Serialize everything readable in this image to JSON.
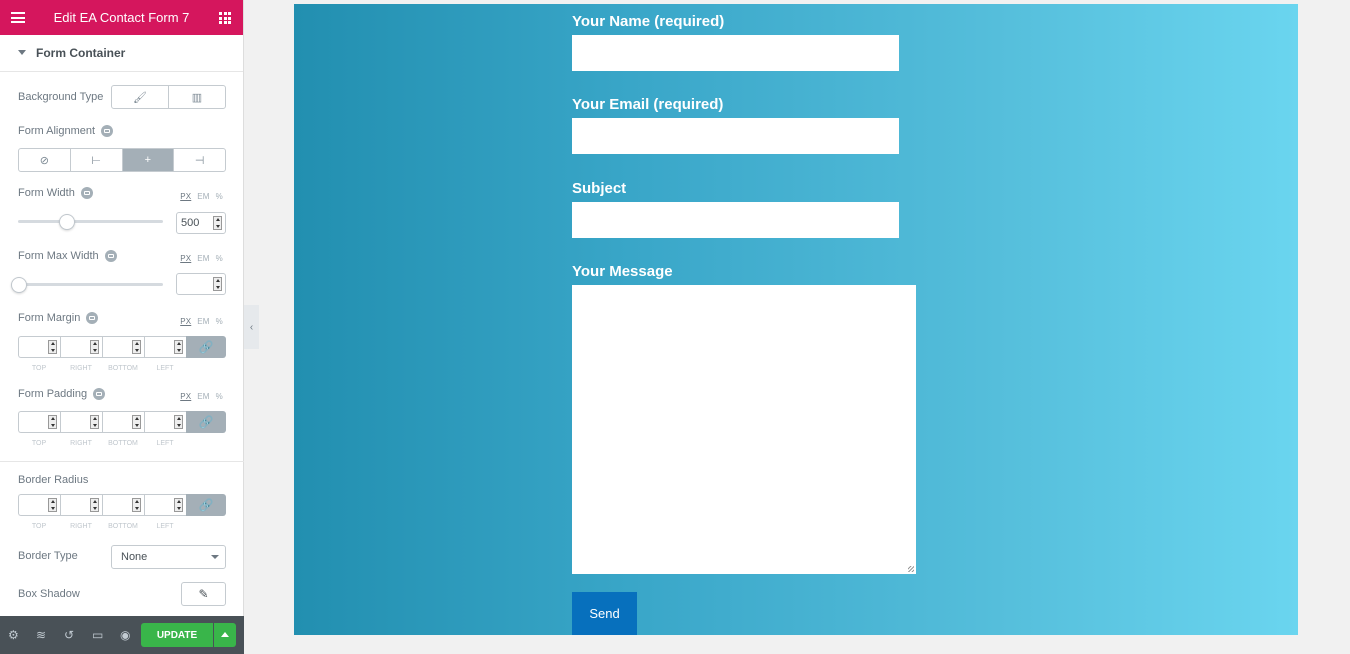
{
  "header": {
    "title": "Edit EA Contact Form 7"
  },
  "section": {
    "title": "Form Container"
  },
  "controls": {
    "background_type": "Background Type",
    "form_alignment": "Form Alignment",
    "form_width": {
      "label": "Form Width",
      "value": "500",
      "slider": 0.33
    },
    "form_max_width": {
      "label": "Form Max Width",
      "value": "",
      "slider": 0
    },
    "form_margin": "Form Margin",
    "form_padding": "Form Padding",
    "border_radius": "Border Radius",
    "border_type": {
      "label": "Border Type",
      "value": "None"
    },
    "box_shadow": "Box Shadow"
  },
  "units": {
    "px": "PX",
    "em": "EM",
    "pct": "%"
  },
  "dims": {
    "top": "TOP",
    "right": "RIGHT",
    "bottom": "BOTTOM",
    "left": "LEFT"
  },
  "footer": {
    "update": "UPDATE"
  },
  "preview": {
    "name_label": "Your Name (required)",
    "email_label": "Your Email (required)",
    "subject_label": "Subject",
    "message_label": "Your Message",
    "send": "Send"
  },
  "colors": {
    "brand": "#d5165d",
    "update": "#39b54a",
    "send": "#0770bd"
  }
}
